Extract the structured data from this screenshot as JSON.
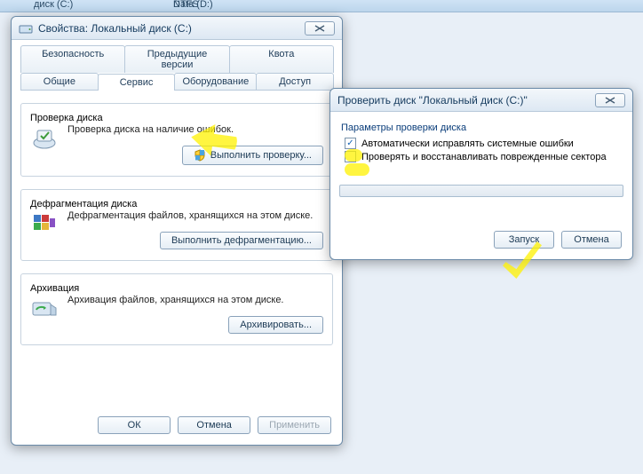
{
  "bg": {
    "disk_c": "диск (С:)",
    "disk_d": "Data (D:)",
    "ntfs": "NTFS"
  },
  "props": {
    "title": "Свойства: Локальный диск (C:)",
    "tabs_row1": [
      "Безопасность",
      "Предыдущие версии",
      "Квота"
    ],
    "tabs_row2": [
      "Общие",
      "Сервис",
      "Оборудование",
      "Доступ"
    ],
    "active_tab_index": 1,
    "check_group": {
      "legend": "Проверка диска",
      "text": "Проверка диска на наличие ошибок.",
      "button": "Выполнить проверку..."
    },
    "defrag_group": {
      "legend": "Дефрагментация диска",
      "text": "Дефрагментация файлов, хранящихся на этом диске.",
      "button": "Выполнить дефрагментацию..."
    },
    "backup_group": {
      "legend": "Архивация",
      "text": "Архивация файлов, хранящихся на этом диске.",
      "button": "Архивировать..."
    },
    "footer": {
      "ok": "ОК",
      "cancel": "Отмена",
      "apply": "Применить"
    }
  },
  "dlg": {
    "title": "Проверить диск \"Локальный диск (C:)\"",
    "params_label": "Параметры проверки диска",
    "opt1": "Автоматически исправлять системные ошибки",
    "opt1_checked": true,
    "opt2": "Проверять и восстанавливать поврежденные сектора",
    "opt2_checked": false,
    "start": "Запуск",
    "cancel": "Отмена"
  }
}
